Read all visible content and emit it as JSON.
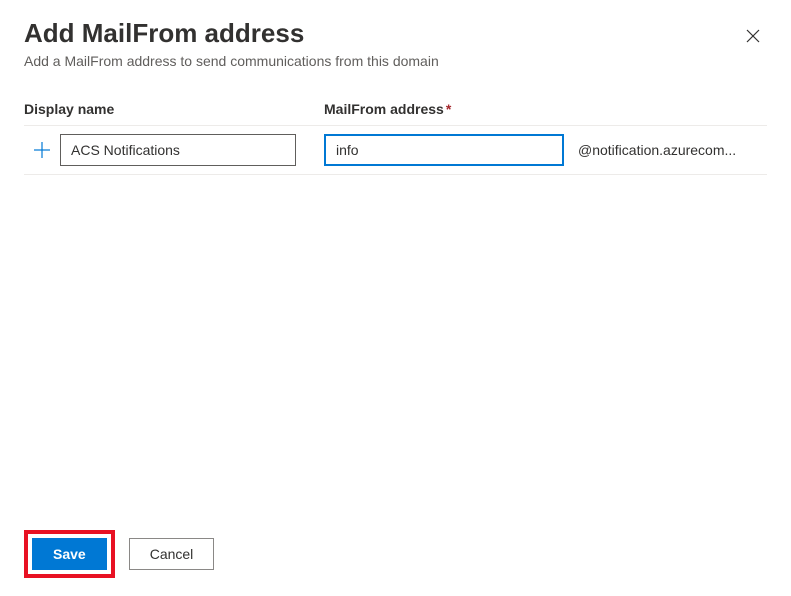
{
  "header": {
    "title": "Add MailFrom address",
    "subtitle": "Add a MailFrom address to send communications from this domain"
  },
  "form": {
    "display_name_label": "Display name",
    "mailfrom_label": "MailFrom address",
    "required_marker": "*",
    "display_name_value": "ACS Notifications",
    "mailfrom_value": "info",
    "domain_suffix": "@notification.azurecom..."
  },
  "footer": {
    "save_label": "Save",
    "cancel_label": "Cancel"
  }
}
